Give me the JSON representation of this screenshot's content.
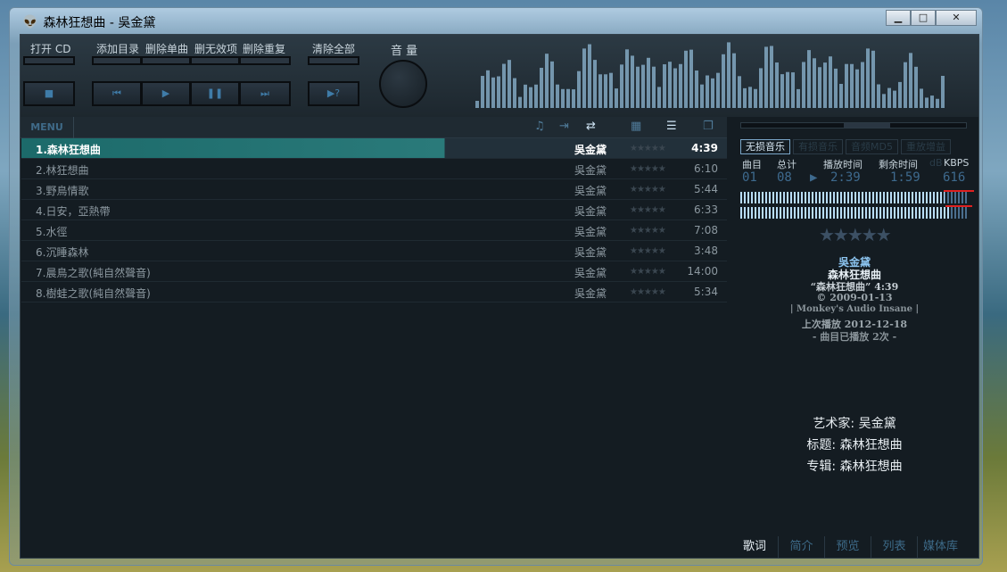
{
  "window": {
    "title": "森林狂想曲 - 吳金黛",
    "minimize": "▁",
    "maximize": "□",
    "close": "✕"
  },
  "controls": {
    "open_cd": "打开 CD",
    "add_dir": "添加目录",
    "del_one": "删除单曲",
    "del_invalid": "删无效项",
    "del_dup": "删除重复",
    "clear_all": "清除全部",
    "volume": "音 量",
    "stop": "■",
    "prev": "⏮",
    "play": "▶",
    "pause": "❚❚",
    "next": "⏭",
    "random": "▶?"
  },
  "toolbar": {
    "menu": "MENU"
  },
  "playlist": [
    {
      "title": "1.森林狂想曲",
      "artist": "吳金黛",
      "rating": "★★★★★",
      "time": "4:39"
    },
    {
      "title": "2.林狂想曲",
      "artist": "吳金黛",
      "rating": "★★★★★",
      "time": "6:10"
    },
    {
      "title": "3.野鳥情歌",
      "artist": "吳金黛",
      "rating": "★★★★★",
      "time": "5:44"
    },
    {
      "title": "4.日安，亞熱帶",
      "artist": "吳金黛",
      "rating": "★★★★★",
      "time": "6:33"
    },
    {
      "title": "5.水徑",
      "artist": "吳金黛",
      "rating": "★★★★★",
      "time": "7:08"
    },
    {
      "title": "6.沉睡森林",
      "artist": "吳金黛",
      "rating": "★★★★★",
      "time": "3:48"
    },
    {
      "title": "7.晨鳥之歌(純自然聲音)",
      "artist": "吳金黛",
      "rating": "★★★★★",
      "time": "14:00"
    },
    {
      "title": "8.樹蛙之歌(純自然聲音)",
      "artist": "吳金黛",
      "rating": "★★★★★",
      "time": "5:34"
    }
  ],
  "right": {
    "tabs": [
      "无损音乐",
      "有损音乐",
      "音频MD5",
      "重放增益"
    ],
    "headers": {
      "track": "曲目",
      "total": "总计",
      "played": "播放时间",
      "remain": "剩余时间",
      "db": "dB",
      "kbps": "KBPS"
    },
    "digits": {
      "track": "01",
      "total": "08",
      "played": "2:39",
      "remain": "1:59",
      "kbps": "616"
    },
    "meter_levels": [
      0.9,
      0.92
    ],
    "rating": "★★★★★",
    "info": {
      "artist": "吳金黛",
      "album": "森林狂想曲",
      "title_line": "“森林狂想曲” 4:39",
      "date": "© 2009-01-13",
      "codec": "| Monkey's Audio Insane |",
      "last_played": "上次播放 2012-12-18",
      "play_count": "- 曲目已播放 2次 -"
    },
    "tags": {
      "artist": "艺术家: 吴金黛",
      "title": "标题: 森林狂想曲",
      "album": "专辑: 森林狂想曲"
    },
    "bottom_tabs": [
      "歌词",
      "简介",
      "预览",
      "列表",
      "媒体库"
    ]
  },
  "colors": {
    "accent": "#2a7a7a",
    "panel": "#141c22"
  }
}
